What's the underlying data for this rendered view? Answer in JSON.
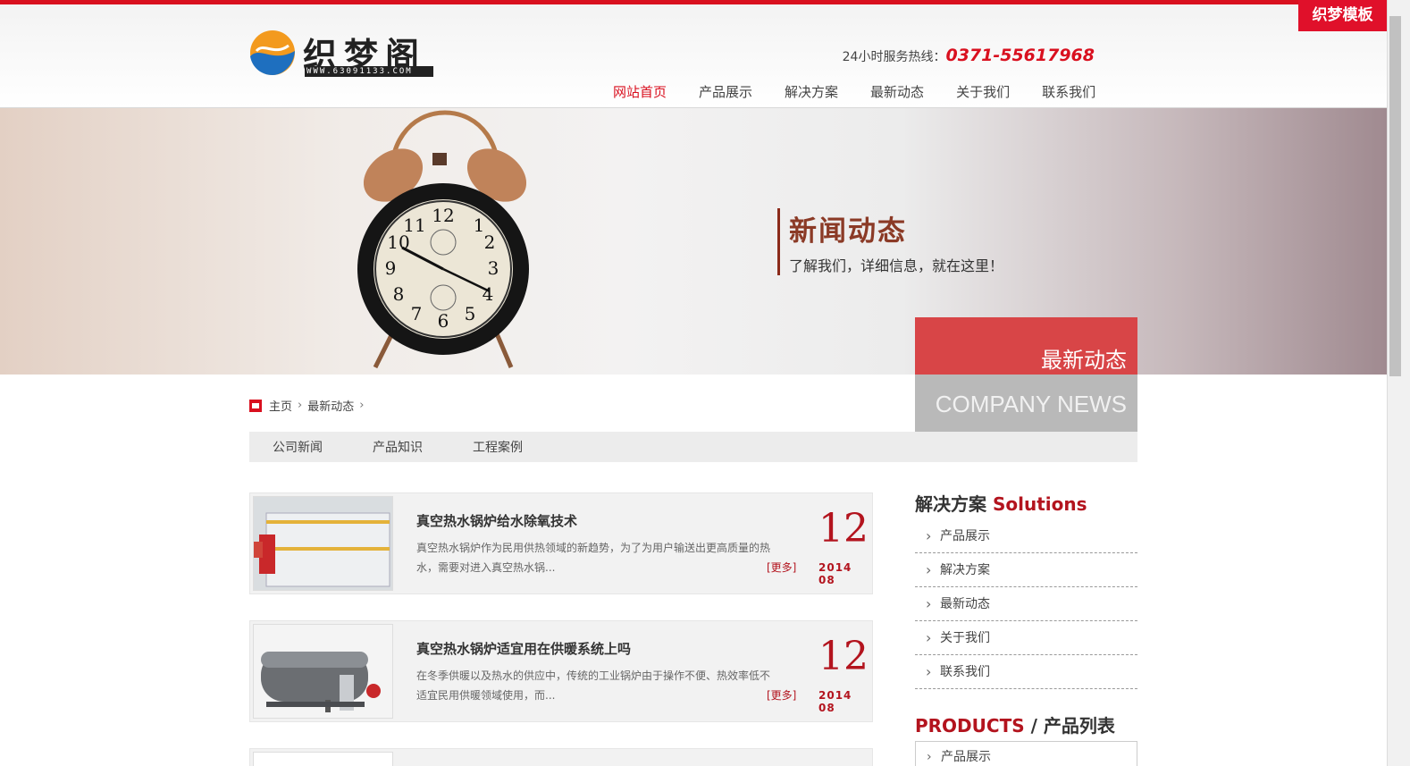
{
  "header": {
    "brand_tag": "织梦模板",
    "logo_text": "织梦阁",
    "logo_url": "WWW.63091133.COM",
    "hotline_label": "24小时服务热线：",
    "hotline_number": "0371-55617968",
    "nav": [
      {
        "label": "网站首页",
        "active": true
      },
      {
        "label": "产品展示",
        "active": false
      },
      {
        "label": "解决方案",
        "active": false
      },
      {
        "label": "最新动态",
        "active": false
      },
      {
        "label": "关于我们",
        "active": false
      },
      {
        "label": "联系我们",
        "active": false
      }
    ]
  },
  "banner": {
    "title": "新闻动态",
    "subtitle": "了解我们，详细信息，就在这里！"
  },
  "category_box": {
    "cn": "最新动态",
    "en": "COMPANY NEWS"
  },
  "breadcrumb": {
    "home": "主页",
    "current": "最新动态"
  },
  "subnav": [
    "公司新闻",
    "产品知识",
    "工程案例"
  ],
  "news": [
    {
      "title": "真空热水锅炉给水除氧技术",
      "desc": "真空热水锅炉作为民用供热领域的新趋势，为了为用户输送出更高质量的热水，需要对进入真空热水锅...",
      "more": "[更多]",
      "day": "12",
      "ym": "2014 08"
    },
    {
      "title": "真空热水锅炉适宜用在供暖系统上吗",
      "desc": "在冬季供暖以及热水的供应中，传统的工业锅炉由于操作不便、热效率低不适宜民用供暖领域使用，而...",
      "more": "[更多]",
      "day": "12",
      "ym": "2014 08"
    }
  ],
  "sidebar": {
    "solutions_cn": "解决方案",
    "solutions_en": "Solutions",
    "items": [
      "产品展示",
      "解决方案",
      "最新动态",
      "关于我们",
      "联系我们"
    ],
    "products_en": "PRODUCTS",
    "products_cn": "/ 产品列表",
    "product_items": [
      "产品展示"
    ]
  },
  "colors": {
    "accent": "#d9101f",
    "dark_red": "#b3141e"
  }
}
